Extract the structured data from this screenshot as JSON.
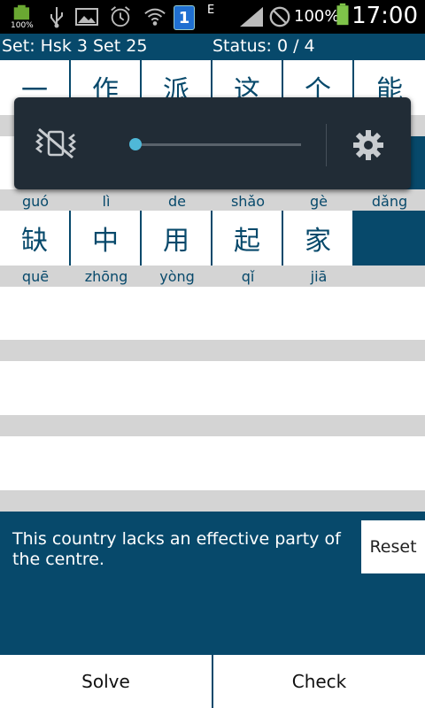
{
  "status_bar": {
    "battery_small_label": "100%",
    "sim_badge": "1",
    "network_type": "E",
    "battery_percent": "100%",
    "clock": "17:00"
  },
  "header": {
    "set_label": "Set: Hsk 3 Set 25",
    "status_label": "Status: 0 / 4"
  },
  "grid": {
    "row1": {
      "chars": [
        "一",
        "作",
        "派",
        "这",
        "个",
        "能"
      ]
    },
    "row2": {
      "pinyin": [
        "guó",
        "lì",
        "de",
        "shǎo",
        "gè",
        "dǎng"
      ]
    },
    "row3": {
      "chars": [
        "缺",
        "中",
        "用",
        "起",
        "家"
      ],
      "pinyin": [
        "quē",
        "zhōng",
        "yòng",
        "qǐ",
        "jiā"
      ]
    }
  },
  "volume_overlay": {
    "mute_icon": "vibrate-mute-icon",
    "settings_icon": "gear-icon",
    "level": 0
  },
  "sentence_panel": {
    "sentence": "This country lacks an effective party of the centre.",
    "reset_label": "Reset"
  },
  "actions": {
    "solve_label": "Solve",
    "check_label": "Check"
  },
  "colors": {
    "primary": "#07496b",
    "band": "#d4d4d4",
    "overlay": "#212c36",
    "slider_accent": "#4fb8d8"
  }
}
